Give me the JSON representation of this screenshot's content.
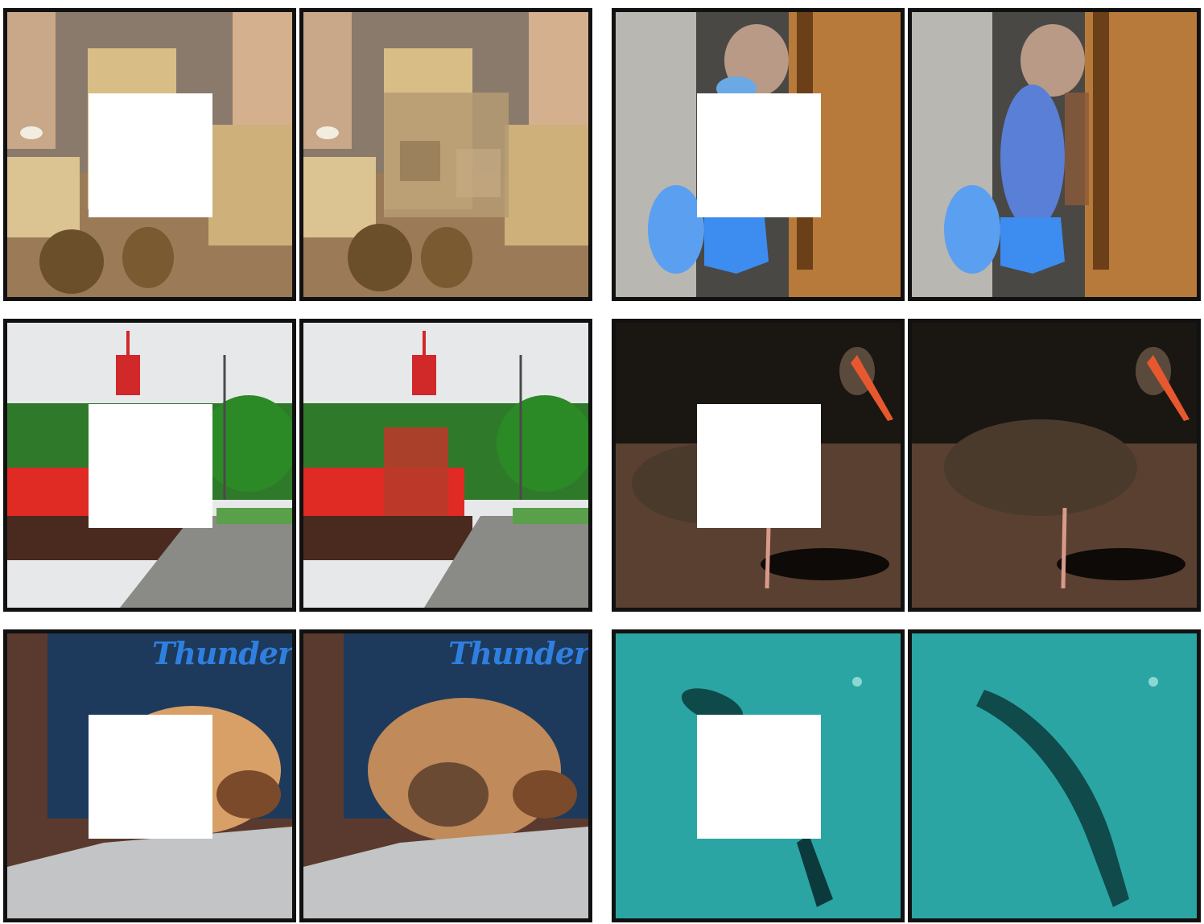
{
  "figure": {
    "description_rows": 3,
    "description_cols_per_row": 4,
    "mask_color": "#ffffff",
    "border_color": "#111111"
  },
  "shirt_text": "Thunderbirds",
  "tiles": [
    {
      "scene": "nursery-teddy-bears",
      "variant": "masked"
    },
    {
      "scene": "nursery-teddy-bears",
      "variant": "inpainted"
    },
    {
      "scene": "blue-socks-doorway",
      "variant": "masked"
    },
    {
      "scene": "blue-socks-doorway",
      "variant": "inpainted"
    },
    {
      "scene": "red-lightship-road",
      "variant": "masked"
    },
    {
      "scene": "red-lightship-road",
      "variant": "inpainted"
    },
    {
      "scene": "black-stork",
      "variant": "masked"
    },
    {
      "scene": "black-stork",
      "variant": "inpainted"
    },
    {
      "scene": "puppy-in-lap",
      "variant": "masked"
    },
    {
      "scene": "puppy-in-lap",
      "variant": "inpainted"
    },
    {
      "scene": "fish-on-sand",
      "variant": "masked"
    },
    {
      "scene": "fish-on-sand",
      "variant": "inpainted"
    }
  ]
}
